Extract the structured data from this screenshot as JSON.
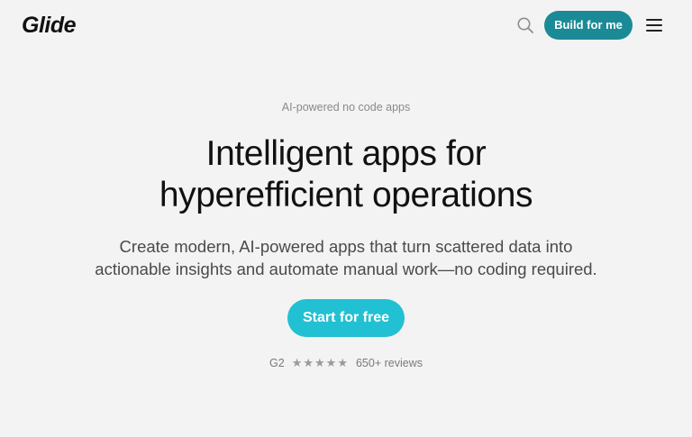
{
  "header": {
    "logo": "Glide",
    "search_icon": "search-icon",
    "cta_label": "Build for me",
    "menu_icon": "hamburger-menu-icon",
    "accent_color": "#1a8b96"
  },
  "hero": {
    "eyebrow": "AI-powered no code apps",
    "headline_line1": "Intelligent apps for",
    "headline_line2": "hyperefficient operations",
    "subhead_line1": "Create modern, AI-powered apps that turn scattered data into",
    "subhead_line2": "actionable insights and automate manual work—no coding required.",
    "cta_label": "Start for free",
    "cta_color": "#22c0d3"
  },
  "rating": {
    "source": "G2",
    "stars": "★★★★★",
    "star_count": 5,
    "reviews": "650+ reviews"
  }
}
